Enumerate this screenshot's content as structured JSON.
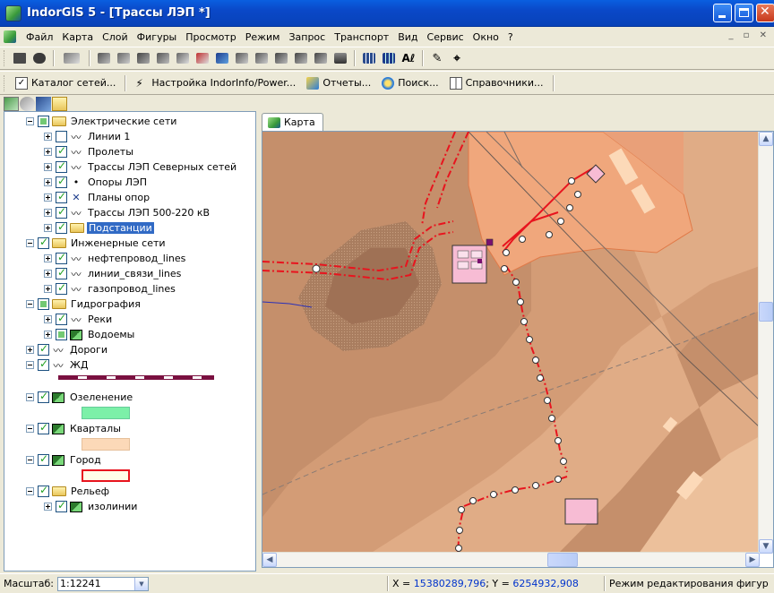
{
  "window": {
    "title": "IndorGIS 5 - [Трассы ЛЭП *]"
  },
  "menu": [
    "Файл",
    "Карта",
    "Слой",
    "Фигуры",
    "Просмотр",
    "Режим",
    "Запрос",
    "Транспорт",
    "Вид",
    "Сервис",
    "Окно",
    "?"
  ],
  "toolbar2": {
    "catalog": "Каталог сетей...",
    "settings": "Настройка IndorInfo/Power...",
    "reports": "Отчеты...",
    "search": "Поиск...",
    "reference": "Справочники..."
  },
  "map_tab": "Карта",
  "layers": {
    "electric": "Электрические сети",
    "lines1": "Линии 1",
    "spans": "Пролеты",
    "north": "Трассы ЛЭП Северных сетей",
    "poles": "Опоры ЛЭП",
    "pole_plans": "Планы опор",
    "routes500": "Трассы ЛЭП 500-220 кВ",
    "substations": "Подстанции",
    "engineering": "Инженерные сети",
    "oil": "нефтепровод_lines",
    "comm": "линии_связи_lines",
    "gas": "газопровод_lines",
    "hydro": "Гидрография",
    "rivers": "Реки",
    "ponds": "Водоемы",
    "roads": "Дороги",
    "rail": "ЖД",
    "green": "Озеленение",
    "blocks": "Кварталы",
    "city": "Город",
    "relief": "Рельеф",
    "isolines": "изолинии"
  },
  "status": {
    "scale_label": "Масштаб:",
    "scale_value": "1:12241",
    "x_label": "X = ",
    "x_value": "15380289,796",
    "y_label": "; Y = ",
    "y_value": "6254932,908",
    "mode": "Режим редактирования фигур"
  },
  "colors": {
    "accent": "#316ac5",
    "route": "#e8141e",
    "green_swatch": "#7cf0a8",
    "block_swatch": "#fcd9b8",
    "city_border": "#e8141e"
  }
}
